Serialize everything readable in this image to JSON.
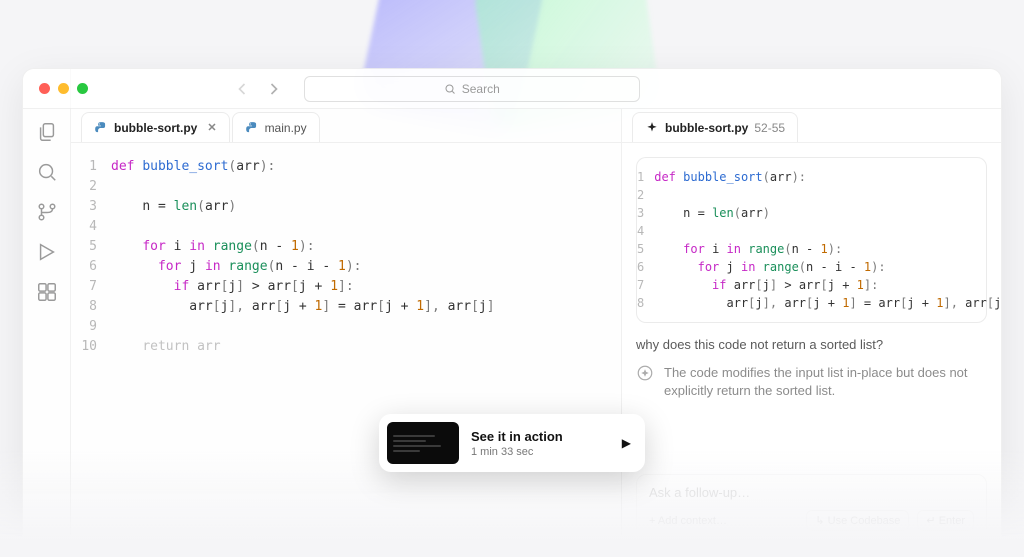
{
  "search": {
    "placeholder": "Search"
  },
  "tabs": [
    {
      "label": "bubble-sort.py",
      "active": true
    },
    {
      "label": "main.py",
      "active": false
    }
  ],
  "editor": {
    "line_numbers": [
      "1",
      "2",
      "3",
      "4",
      "5",
      "6",
      "7",
      "8",
      "9",
      "10"
    ]
  },
  "chat": {
    "file": "bubble-sort.py",
    "range": "52-55",
    "snippet_line_numbers": [
      "1",
      "2",
      "3",
      "4",
      "5",
      "6",
      "7",
      "8"
    ],
    "question": "why does this code not return a sorted list?",
    "answer": "The code modifies the input list in-place but does not explicitly return the sorted list.",
    "followup_placeholder": "Ask a follow-up…",
    "add_context": "+ Add context…",
    "use_codebase": "↳ Use Codebase",
    "enter": "↵ Enter"
  },
  "cta": {
    "title": "See it in action",
    "subtitle": "1 min 33 sec"
  }
}
